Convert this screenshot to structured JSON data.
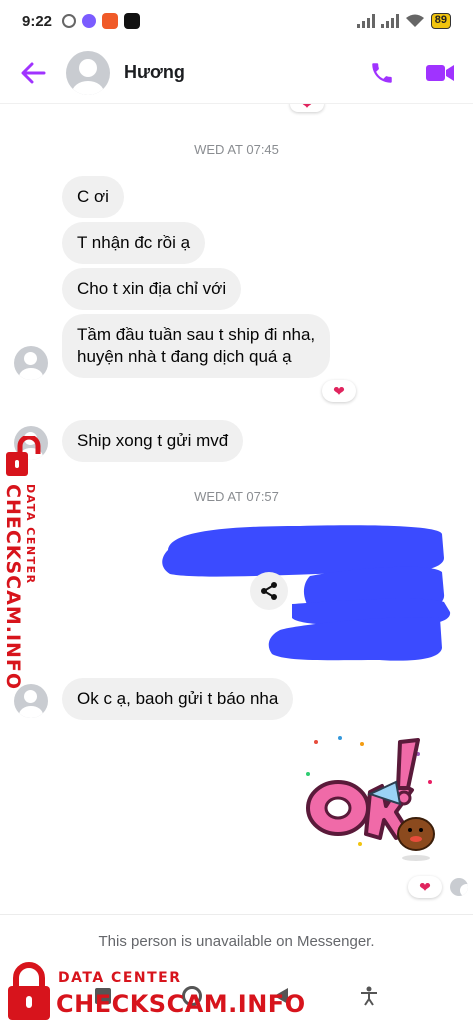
{
  "status_bar": {
    "time": "9:22",
    "battery": "89"
  },
  "header": {
    "contact_name": "Hương"
  },
  "timestamps": [
    "WED AT 07:45",
    "WED AT 07:57"
  ],
  "messages": [
    {
      "text": "C ơi"
    },
    {
      "text": "T nhận đc rồi ạ"
    },
    {
      "text": "Cho t xin địa chỉ với"
    },
    {
      "text": "Tầm đầu tuần sau t ship đi nha,",
      "text2": "huyện nhà t đang dịch quá ạ",
      "reaction": "heart-reaction"
    },
    {
      "text": "Ship xong t gửi mvđ"
    },
    {
      "text": "Ok c ạ, baoh gửi t báo nha"
    }
  ],
  "sticker": {
    "text": "OK!",
    "reaction": "heart-reaction"
  },
  "footer": {
    "unavailable_note": "This person is unavailable on Messenger."
  },
  "watermark": {
    "line1": "DATA CENTER",
    "line2": "CHECKSCAM.INFO"
  },
  "colors": {
    "accent": "#a033ff",
    "redaction": "#3b4bff",
    "watermark": "#d7141c"
  }
}
